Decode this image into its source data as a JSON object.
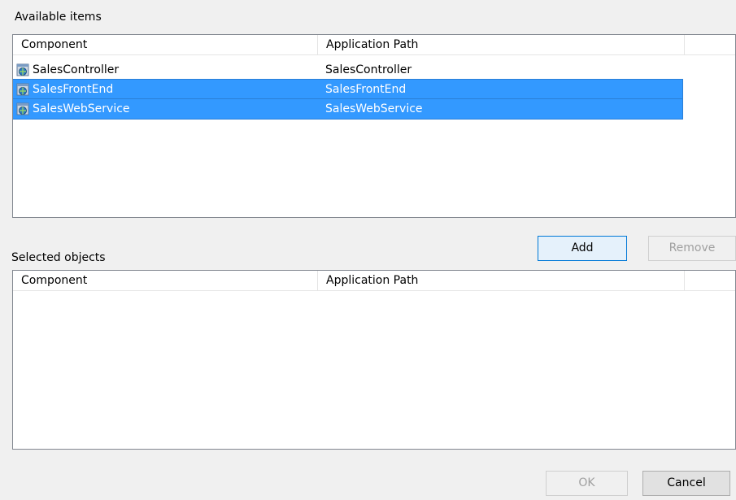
{
  "available": {
    "label": "Available items",
    "columns": [
      "Component",
      "Application Path"
    ],
    "rows": [
      {
        "component": "SalesController",
        "path": "SalesController",
        "icon": "web-service-icon",
        "selected": false
      },
      {
        "component": "SalesFrontEnd",
        "path": "SalesFrontEnd",
        "icon": "web-service-icon",
        "selected": true
      },
      {
        "component": "SalesWebService",
        "path": "SalesWebService",
        "icon": "web-service-icon",
        "selected": true
      }
    ]
  },
  "selected": {
    "label": "Selected objects",
    "columns": [
      "Component",
      "Application Path"
    ],
    "rows": []
  },
  "buttons": {
    "add": "Add",
    "remove": "Remove",
    "ok": "OK",
    "cancel": "Cancel"
  },
  "colors": {
    "selection": "#3399ff",
    "accent_border": "#0078d7"
  }
}
